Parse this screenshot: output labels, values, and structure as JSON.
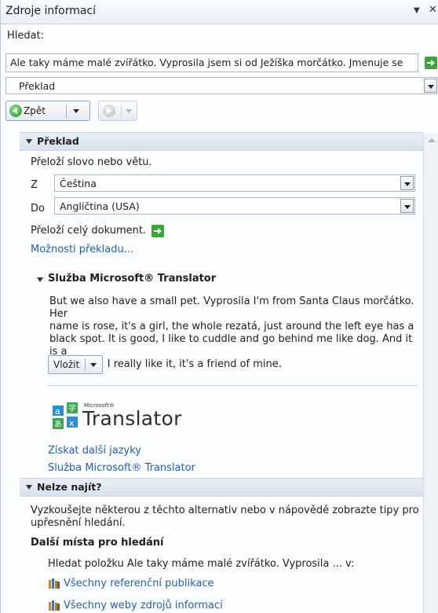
{
  "pane": {
    "title": "Zdroje informací"
  },
  "search": {
    "label": "Hledat:",
    "value": "Ale taky máme malé zvířátko. Vyprosila jsem si od Ježíška morčátko. Jmenuje se",
    "service": "Překlad"
  },
  "toolbar": {
    "back_label": "Zpět"
  },
  "translation": {
    "header": "Překlad",
    "instruction": "Přeloží slovo nebo větu.",
    "from_label": "Z",
    "from_value": "Čeština",
    "to_label": "Do",
    "to_value": "Angličtina (USA)",
    "translate_doc": "Přeloží celý dokument.",
    "options_link": "Možnosti překladu..."
  },
  "translator_service": {
    "header": "Služba Microsoft® Translator",
    "result_lines": [
      "But we also have a small pet. Vyprosila I'm from Santa Claus morčátko. Her",
      "name is rose, it's a girl, the whole rezatá, just around the left eye has a",
      "black spot. It is good, I like to cuddle and go behind me like dog. And it is a",
      "nice tooth. I really like it, it's a friend of mine."
    ],
    "insert_button": "Vložit",
    "logo_small": "Microsoft®",
    "logo_big": "Translator",
    "link_more_languages": "Získat další jazyky",
    "link_service": "Služba Microsoft® Translator"
  },
  "not_found": {
    "header": "Nelze najít?",
    "hint_lines": [
      "Vyzkoušejte některou z těchto alternativ nebo v nápovědě zobrazte tipy pro",
      "upřesnění hledání."
    ],
    "more_places": "Další místa pro hledání",
    "search_item": "Hledat položku Ale taky máme malé zvířátko. Vyprosila ... v:",
    "all_references": "Všechny referenční publikace",
    "all_websites": "Všechny weby zdrojů informací"
  },
  "colors": {
    "link": "#1f5fb8",
    "go_green": "#3aa63a",
    "header_bg": "#dfe7f0"
  }
}
